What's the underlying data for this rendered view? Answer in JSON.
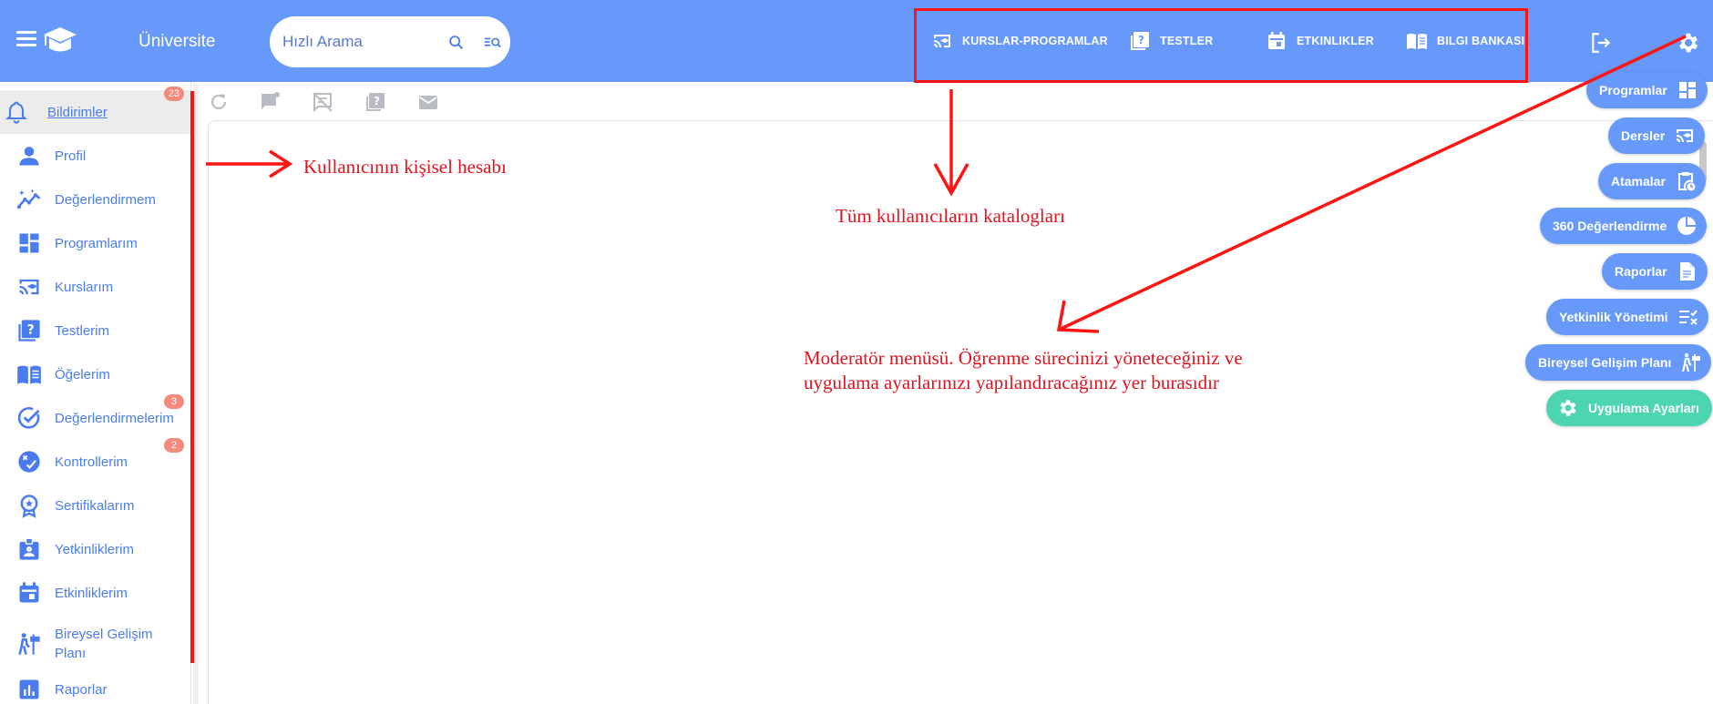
{
  "header": {
    "app_title": "Üniversite",
    "search": {
      "placeholder": "Hızlı Arama"
    },
    "nav": [
      {
        "label": "KURSLAR-PROGRAMLAR",
        "icon": "cast-for-education-icon"
      },
      {
        "label": "TESTLER",
        "icon": "quiz-icon"
      },
      {
        "label": "ETKINLIKLER",
        "icon": "calendar-icon"
      },
      {
        "label": "BILGI BANKASI",
        "icon": "menu-book-icon"
      }
    ]
  },
  "sidebar": {
    "items": [
      {
        "label": "Bildirimler",
        "icon": "bell-icon",
        "badge": "23",
        "active": true
      },
      {
        "label": "Profil",
        "icon": "person-icon"
      },
      {
        "label": "Değerlendirmem",
        "icon": "insights-icon"
      },
      {
        "label": "Programlarım",
        "icon": "dashboard-icon"
      },
      {
        "label": "Kurslarım",
        "icon": "cast-for-education-icon"
      },
      {
        "label": "Testlerim",
        "icon": "quiz-icon"
      },
      {
        "label": "Öğelerim",
        "icon": "menu-book-icon"
      },
      {
        "label": "Değerlendirmelerim",
        "icon": "check-circle-icon",
        "badge": "3"
      },
      {
        "label": "Kontrollerim",
        "icon": "rule-circle-icon",
        "badge": "2"
      },
      {
        "label": "Sertifikalarım",
        "icon": "award-icon"
      },
      {
        "label": "Yetkinliklerim",
        "icon": "badge-icon"
      },
      {
        "label": "Etkinliklerim",
        "icon": "calendar-icon"
      },
      {
        "label": "Bireysel Gelişim Planı",
        "icon": "hiking-signpost-icon"
      },
      {
        "label": "Raporlar",
        "icon": "bar-chart-icon"
      }
    ]
  },
  "moderator_menu": [
    {
      "label": "Programlar",
      "icon": "dashboard-icon"
    },
    {
      "label": "Dersler",
      "icon": "cast-for-education-icon"
    },
    {
      "label": "Atamalar",
      "icon": "clipboard-clock-icon"
    },
    {
      "label": "360 Değerlendirme",
      "icon": "pie-chart-icon"
    },
    {
      "label": "Raporlar",
      "icon": "document-icon"
    },
    {
      "label": "Yetkinlik Yönetimi",
      "icon": "rule-list-icon"
    },
    {
      "label": "Bireysel Gelişim Planı",
      "icon": "hiking-signpost-icon"
    },
    {
      "label": "Uygulama Ayarları",
      "icon": "gear-icon",
      "color": "#4dd4b0"
    }
  ],
  "annotations": {
    "personal_account": "Kullanıcının kişisel hesabı",
    "catalogs": "Tüm kullanıcıların katalogları",
    "moderator_line1": "Moderatör menüsü. Öğrenme sürecinizi yöneteceğiniz ve",
    "moderator_line2": "uygulama ayarlarınızı yapılandıracağınız yer burasıdır"
  },
  "colors": {
    "topbar": "#6799fb",
    "accent_text": "#4a7cf0",
    "annotation_red": "#e0141f",
    "badge": "#f48a7c",
    "settings_button": "#4dd4b0"
  }
}
